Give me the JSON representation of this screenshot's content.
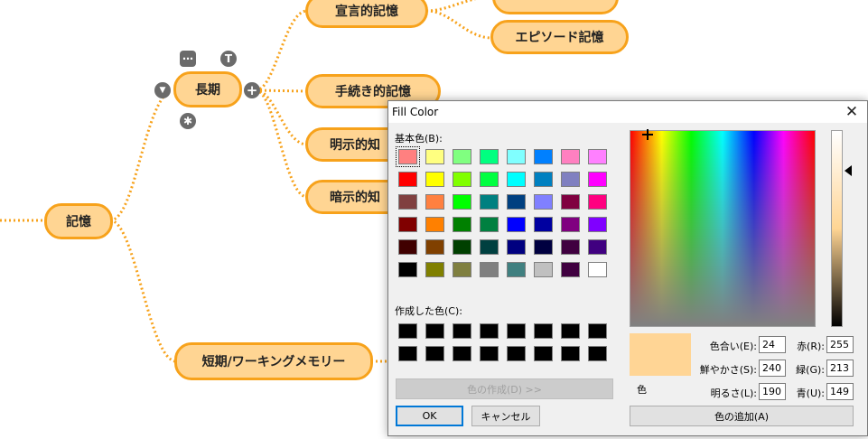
{
  "mindmap": {
    "nodes": {
      "root": "記憶",
      "long_term": "長期",
      "declarative": "宣言的記憶",
      "episodic": "エピソード記憶",
      "procedural": "手続き的記憶",
      "explicit": "明示的知",
      "implicit": "暗示的知",
      "short_term": "短期/ワーキングメモリー"
    },
    "line_color": "#f7a21b",
    "node_fill": "#ffd593",
    "controls": {
      "more": "⋯",
      "text": "T",
      "collapse": "▼",
      "add": "+",
      "asterisk": "✱"
    }
  },
  "dialog": {
    "title": "Fill Color",
    "close": "✕",
    "basic_colors_label": "基本色(B):",
    "basic_colors": [
      [
        "#ff8080",
        "#ffff80",
        "#80ff80",
        "#00ff80",
        "#80ffff",
        "#0080ff",
        "#ff80c0",
        "#ff80ff"
      ],
      [
        "#ff0000",
        "#ffff00",
        "#80ff00",
        "#00ff40",
        "#00ffff",
        "#0080c0",
        "#8080c0",
        "#ff00ff"
      ],
      [
        "#804040",
        "#ff8040",
        "#00ff00",
        "#008080",
        "#004080",
        "#8080ff",
        "#800040",
        "#ff0080"
      ],
      [
        "#800000",
        "#ff8000",
        "#008000",
        "#008040",
        "#0000ff",
        "#0000a0",
        "#800080",
        "#8000ff"
      ],
      [
        "#400000",
        "#804000",
        "#004000",
        "#004040",
        "#000080",
        "#000040",
        "#400040",
        "#400080"
      ],
      [
        "#000000",
        "#808000",
        "#808040",
        "#808080",
        "#408080",
        "#c0c0c0",
        "#400040",
        "#ffffff"
      ]
    ],
    "custom_colors_label": "作成した色(C):",
    "custom_colors": [
      [
        "#000000",
        "#000000",
        "#000000",
        "#000000",
        "#000000",
        "#000000",
        "#000000",
        "#000000"
      ],
      [
        "#000000",
        "#000000",
        "#000000",
        "#000000",
        "#000000",
        "#000000",
        "#000000",
        "#000000"
      ]
    ],
    "define_custom_button": "色の作成(D) >>",
    "ok_button": "OK",
    "cancel_button": "キャンセル",
    "preview_label": "色",
    "preview_color": "#ffd595",
    "hue_label": "色合い(E):",
    "hue": "24",
    "sat_label": "鮮やかさ(S):",
    "sat": "240",
    "lum_label": "明るさ(L):",
    "lum": "190",
    "red_label": "赤(R):",
    "red": "255",
    "green_label": "緑(G):",
    "green": "213",
    "blue_label": "青(U):",
    "blue": "149",
    "add_custom_button": "色の追加(A)"
  }
}
